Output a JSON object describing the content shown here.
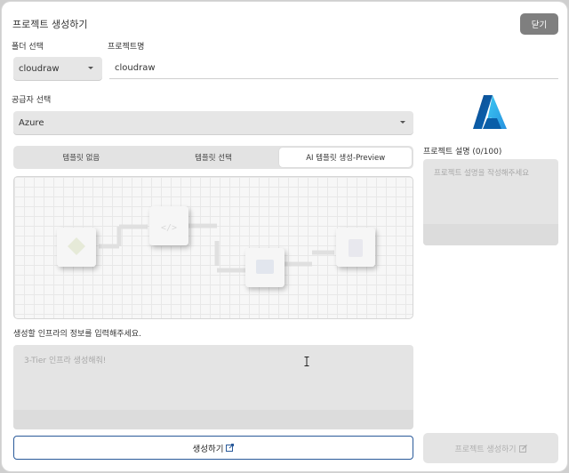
{
  "modal": {
    "title": "프로젝트 생성하기",
    "close_label": "닫기"
  },
  "folder": {
    "label": "폴더 선택",
    "value": "cloudraw"
  },
  "project_name": {
    "label": "프로젝트명",
    "value": "cloudraw"
  },
  "provider": {
    "label": "공급자 선택",
    "value": "Azure"
  },
  "tabs": [
    {
      "label": "템플릿 없음",
      "active": false
    },
    {
      "label": "템플릿 선택",
      "active": false
    },
    {
      "label": "AI 템플릿 생성-Preview",
      "active": true
    }
  ],
  "prompt": {
    "label": "생성할 인프라의 정보를 입력해주세요.",
    "placeholder": "3-Tier 인프라 생성해줘!"
  },
  "generate_label": "생성하기",
  "description": {
    "label": "프로젝트 설명 (0/100)",
    "placeholder": "프로젝트 설명을 작성해주세요"
  },
  "create_label": "프로젝트 생성하기",
  "icons": {
    "logo": "azure-logo",
    "generate": "external-link-icon",
    "create": "edit-icon",
    "cursor": "text-cursor-icon"
  },
  "colors": {
    "azure_light": "#3ccbf4",
    "azure_dark": "#0a5ea8",
    "button_border": "#2a5a9a",
    "close_bg": "#7f7f7f"
  }
}
